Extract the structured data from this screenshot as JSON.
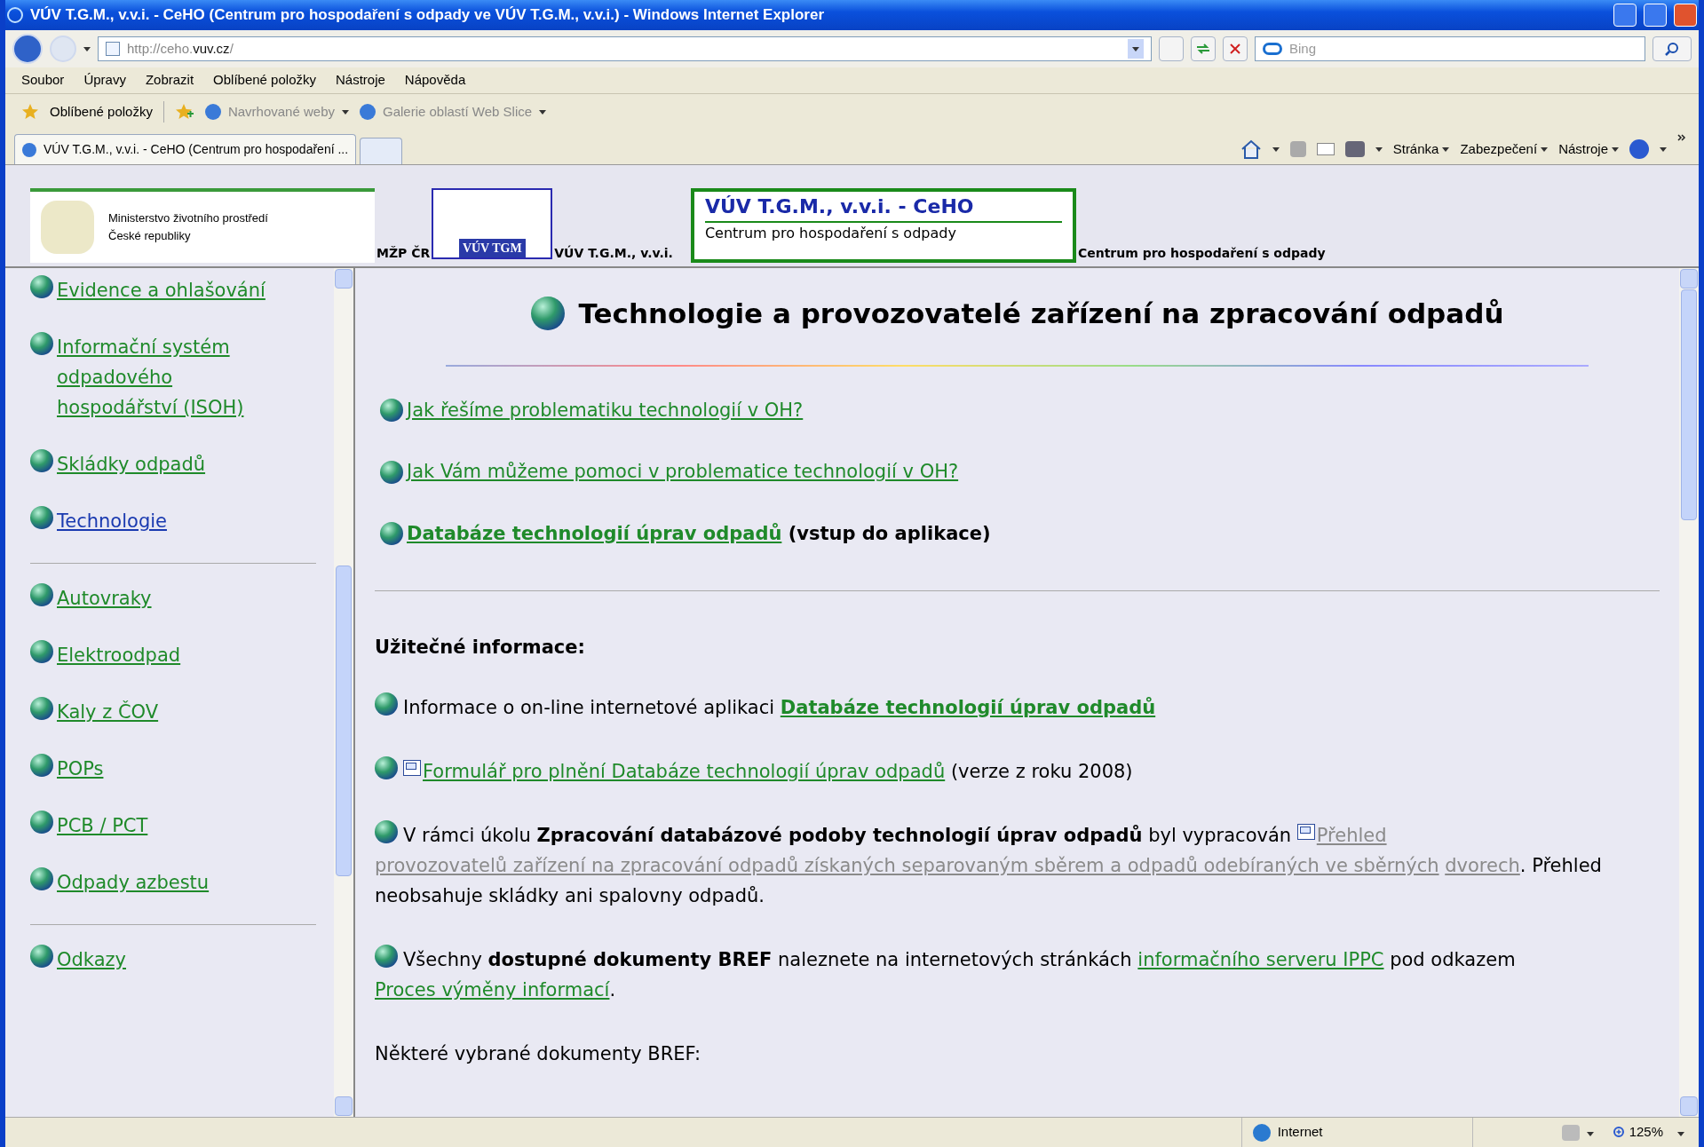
{
  "window": {
    "title": "VÚV T.G.M., v.v.i. - CeHO (Centrum pro hospodaření s odpady ve VÚV T.G.M., v.v.i.) - Windows Internet Explorer"
  },
  "address_bar": {
    "url_prefix": "http://ceho.",
    "url_domain": "vuv.cz",
    "url_suffix": "/"
  },
  "search": {
    "placeholder": "Bing"
  },
  "menu": [
    "Soubor",
    "Úpravy",
    "Zobrazit",
    "Oblíbené položky",
    "Nástroje",
    "Nápověda"
  ],
  "favorites_bar": {
    "label": "Oblíbené položky",
    "items": [
      "Navrhované weby",
      "Galerie oblastí Web Slice"
    ]
  },
  "tabs": [
    {
      "label": "VÚV T.G.M., v.v.i. - CeHO (Centrum pro hospodaření ...",
      "selected": true
    }
  ],
  "command_bar": [
    "Stránka",
    "Zabezpečení",
    "Nástroje"
  ],
  "header": {
    "ministry_logo": [
      "Ministerstvo životního prostředí",
      "České republiky"
    ],
    "ministry_caption": "MŽP ČR",
    "vuv_logo": "VÚV TGM",
    "vuv_caption": "VÚV T.G.M., v.v.i.",
    "ceho_logo": [
      "VÚV T.G.M., v.v.i. - CeHO",
      "Centrum pro hospodaření s odpady"
    ],
    "ceho_caption": "Centrum pro hospodaření s odpady"
  },
  "sidebar": {
    "groups": [
      [
        {
          "label": "Evidence a ohlašování",
          "selected": false
        },
        {
          "label": "Informační systém odpadového hospodářství (ISOH)",
          "selected": false
        },
        {
          "label": "Skládky odpadů",
          "selected": false
        },
        {
          "label": "Technologie",
          "selected": true
        }
      ],
      [
        {
          "label": "Autovraky",
          "selected": false
        },
        {
          "label": "Elektroodpad",
          "selected": false
        },
        {
          "label": "Kaly z ČOV",
          "selected": false
        },
        {
          "label": "POPs",
          "selected": false
        },
        {
          "label": "PCB / PCT",
          "selected": false
        },
        {
          "label": "Odpady azbestu",
          "selected": false
        }
      ],
      [
        {
          "label": "Odkazy",
          "selected": false
        }
      ]
    ]
  },
  "main": {
    "title": "Technologie a provozovatelé zařízení na zpracování odpadů",
    "links": [
      [
        {
          "kind": "link",
          "text": "Jak řešíme problematiku technologií v OH?"
        }
      ],
      [
        {
          "kind": "link",
          "text": "Jak Vám můžeme pomoci v problematice technologií v OH?"
        }
      ],
      [
        {
          "kind": "bold-link",
          "text": "Databáze technologií úprav odpadů"
        },
        {
          "kind": "bold",
          "text": " (vstup do aplikace)"
        }
      ]
    ],
    "section_heading": "Užitečné informace:",
    "info": [
      [
        {
          "kind": "text",
          "text": "Informace o on-line internetové aplikaci "
        },
        {
          "kind": "bold-link",
          "text": "Databáze technologií úprav odpadů"
        }
      ],
      [
        {
          "kind": "doc-icon"
        },
        {
          "kind": "link",
          "text": "Formulář pro plnění Databáze technologií úprav odpadů"
        },
        {
          "kind": "text",
          "text": " (verze z roku 2008)"
        }
      ],
      [
        {
          "kind": "text",
          "text": "V rámci úkolu "
        },
        {
          "kind": "bold",
          "text": "Zpracování databázové podoby technologií úprav odpadů"
        },
        {
          "kind": "text",
          "text": " byl vypracován "
        },
        {
          "kind": "doc-icon"
        },
        {
          "kind": "visited-link",
          "text": "Přehled"
        },
        {
          "kind": "space"
        },
        {
          "kind": "visited-link",
          "text": "provozovatelů zařízení na zpracování odpadů získaných separovaným sběrem a odpadů odebíraných ve sběrných"
        },
        {
          "kind": "space"
        },
        {
          "kind": "visited-link",
          "text": "dvorech"
        },
        {
          "kind": "text",
          "text": ". Přehled neobsahuje skládky ani spalovny odpadů."
        }
      ],
      [
        {
          "kind": "text",
          "text": "Všechny "
        },
        {
          "kind": "bold",
          "text": "dostupné dokumenty BREF"
        },
        {
          "kind": "text",
          "text": " naleznete na internetových stránkách "
        },
        {
          "kind": "link",
          "text": "informačního serveru IPPC"
        },
        {
          "kind": "text",
          "text": " pod odkazem "
        },
        {
          "kind": "link",
          "text": "Proces výměny informací"
        },
        {
          "kind": "text",
          "text": "."
        }
      ]
    ],
    "closing_text": "Některé vybrané dokumenty BREF:"
  },
  "status_bar": {
    "zone": "Internet",
    "zoom": "125%"
  }
}
